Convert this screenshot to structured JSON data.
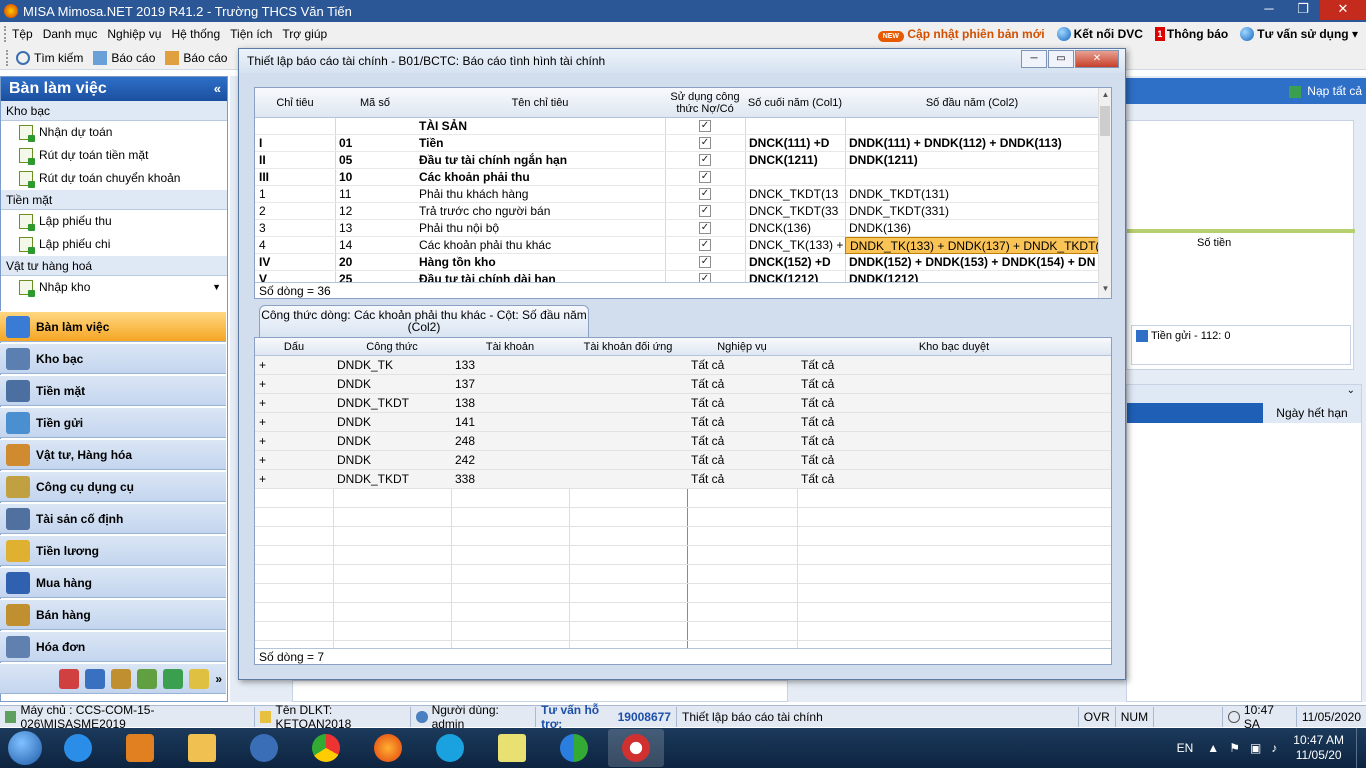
{
  "app": {
    "title": "MISA Mimosa.NET 2019 R41.2 - Trường THCS Văn Tiến"
  },
  "menu": {
    "items": [
      "Tệp",
      "Danh mục",
      "Nghiệp vụ",
      "Hệ thống",
      "Tiện ích",
      "Trợ giúp"
    ],
    "new_badge": "NEW",
    "update": "Cập nhật phiên bản mới",
    "dvc": "Kết nối DVC",
    "notify_count": "1",
    "notify": "Thông báo",
    "consult": "Tư vấn sử dụng"
  },
  "toolbar": {
    "search": "Tìm kiếm",
    "report": "Báo cáo",
    "report2": "Báo cáo"
  },
  "left": {
    "title": "Bàn làm việc",
    "sections": [
      {
        "name": "Kho bạc",
        "items": [
          "Nhận dự toán",
          "Rút dự toán tiền mặt",
          "Rút dự toán chuyển khoản"
        ]
      },
      {
        "name": "Tiền mặt",
        "items": [
          "Lập phiếu thu",
          "Lập phiếu chi"
        ]
      },
      {
        "name": "Vật tư hàng hoá",
        "items": [
          "Nhập kho"
        ]
      }
    ],
    "nav": [
      "Bàn làm việc",
      "Kho bạc",
      "Tiền mặt",
      "Tiền gửi",
      "Vật tư, Hàng hóa",
      "Công cụ dụng cụ",
      "Tài sản cố định",
      "Tiền lương",
      "Mua hàng",
      "Bán hàng",
      "Hóa đơn"
    ]
  },
  "right": {
    "refresh": "Nạp tất cả",
    "chart_label": "Số tiền",
    "legend": "Tiền gửi - 112: 0",
    "expire": "Ngày hết hạn"
  },
  "dialog": {
    "title": "Thiết lập báo cáo tài chính - B01/BCTC: Báo cáo tình hình tài chính",
    "grid1": {
      "headers": [
        "Chỉ tiêu",
        "Mã số",
        "Tên chỉ tiêu",
        "Sử dụng công thức Nợ/Có",
        "Số cuối năm (Col1)",
        "Số đầu năm (Col2)"
      ],
      "rows": [
        {
          "chi": "",
          "ma": "",
          "ten": "TÀI SẢN",
          "cb": "✓",
          "c1": "",
          "c2": "",
          "bold": true
        },
        {
          "chi": "I",
          "ma": "01",
          "ten": "Tiền",
          "cb": "✓",
          "c1": "DNCK(111) +D",
          "c2": "DNDK(111) + DNDK(112) + DNDK(113)",
          "bold": true
        },
        {
          "chi": "II",
          "ma": "05",
          "ten": "Đầu tư tài chính ngắn hạn",
          "cb": "✓",
          "c1": "DNCK(1211)",
          "c2": "DNDK(1211)",
          "bold": true
        },
        {
          "chi": "III",
          "ma": "10",
          "ten": "Các khoản phải thu",
          "cb": "✓",
          "c1": "",
          "c2": "",
          "bold": true
        },
        {
          "chi": "1",
          "ma": "11",
          "ten": "Phải thu khách hàng",
          "cb": "✓",
          "c1": "DNCK_TKDT(13",
          "c2": "DNDK_TKDT(131)",
          "bold": false
        },
        {
          "chi": "2",
          "ma": "12",
          "ten": "Trả trước cho người bán",
          "cb": "✓",
          "c1": "DNCK_TKDT(33",
          "c2": "DNDK_TKDT(331)",
          "bold": false
        },
        {
          "chi": "3",
          "ma": "13",
          "ten": "Phải thu nội bộ",
          "cb": "✓",
          "c1": "DNCK(136)",
          "c2": "DNDK(136)",
          "bold": false
        },
        {
          "chi": "4",
          "ma": "14",
          "ten": "Các khoản phải thu khác",
          "cb": "✓",
          "c1": "DNCK_TK(133) +",
          "c2": "DNDK_TK(133) + DNDK(137) + DNDK_TKDT(",
          "bold": false
        },
        {
          "chi": "IV",
          "ma": "20",
          "ten": "Hàng tồn kho",
          "cb": "✓",
          "c1": "DNCK(152) +D",
          "c2": "DNDK(152) + DNDK(153) + DNDK(154) + DN",
          "bold": true
        },
        {
          "chi": "V",
          "ma": "25",
          "ten": "Đầu tư tài chính dài hạn",
          "cb": "✓",
          "c1": "DNCK(1212)",
          "c2": "DNDK(1212)",
          "bold": true
        }
      ],
      "footer": "Số dòng = 36"
    },
    "tab": {
      "line1": "Công thức dòng: Các khoản phải thu khác - Cột: Số đầu năm",
      "line2": "(Col2)"
    },
    "grid2": {
      "headers": [
        "Dấu",
        "Công thức",
        "Tài khoản",
        "Tài khoản đối ứng",
        "Nghiệp vụ",
        "Kho bạc duyệt"
      ],
      "rows": [
        {
          "dau": "+",
          "ct": "DNDK_TK",
          "tk": "133",
          "du": "",
          "nv": "Tất cả",
          "kb": "Tất cả"
        },
        {
          "dau": "+",
          "ct": "DNDK",
          "tk": "137",
          "du": "",
          "nv": "Tất cả",
          "kb": "Tất cả"
        },
        {
          "dau": "+",
          "ct": "DNDK_TKDT",
          "tk": "138",
          "du": "",
          "nv": "Tất cả",
          "kb": "Tất cả"
        },
        {
          "dau": "+",
          "ct": "DNDK",
          "tk": "141",
          "du": "",
          "nv": "Tất cả",
          "kb": "Tất cả"
        },
        {
          "dau": "+",
          "ct": "DNDK",
          "tk": "248",
          "du": "",
          "nv": "Tất cả",
          "kb": "Tất cả"
        },
        {
          "dau": "+",
          "ct": "DNDK",
          "tk": "242",
          "du": "",
          "nv": "Tất cả",
          "kb": "Tất cả"
        },
        {
          "dau": "+",
          "ct": "DNDK_TKDT",
          "tk": "338",
          "du": "",
          "nv": "Tất cả",
          "kb": "Tất cả"
        }
      ],
      "footer": "Số dòng = 7"
    }
  },
  "status": {
    "server": "Máy chủ : CCS-COM-15-026\\MISASME2019",
    "db": "Tên DLKT: KETOAN2018",
    "user": "Người dùng: admin",
    "support_label": "Tư vấn hỗ trợ: ",
    "support_phone": "19008677",
    "form": "Thiết lập báo cáo tài chính",
    "ovr": "OVR",
    "num": "NUM",
    "time": "10:47 SA",
    "date": "11/05/2020"
  },
  "taskbar": {
    "lang": "EN",
    "time": "10:47 AM",
    "date": "11/05/20"
  }
}
